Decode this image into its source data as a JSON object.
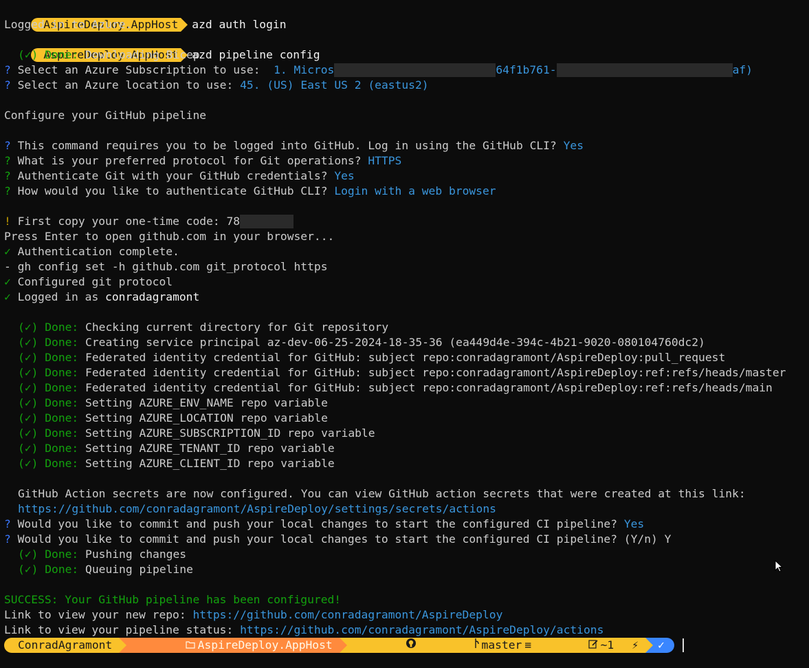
{
  "prompt_label": "AspireDeploy.AppHost",
  "lines": {
    "cmd1": "azd auth login",
    "out1": "Logged in to Azure.",
    "cmd2": "azd pipeline config",
    "done_label": "(✓) Done:",
    "bicep": " Downloading Bicep",
    "q_mark": "?",
    "sub_q": " Select an Azure Subscription to use:  ",
    "sub_a1": "1. Micros",
    "sub_a2": "64f1b761-",
    "sub_a3": "af)",
    "loc_q": " Select an Azure location to use: ",
    "loc_a": "45. (US) East US 2 (eastus2)",
    "configure": "Configure your GitHub pipeline",
    "gh_q1": " This command requires you to be logged into GitHub. Log in using the GitHub CLI? ",
    "gh_a1": "Yes",
    "gh_q2": " What is your preferred protocol for Git operations? ",
    "gh_a2": "HTTPS",
    "gh_q3": " Authenticate Git with your GitHub credentials? ",
    "gh_a3": "Yes",
    "gh_q4": " How would you like to authenticate GitHub CLI? ",
    "gh_a4": "Login with a web browser",
    "bang": "!",
    "code_txt": " First copy your one-time code: 78",
    "press_enter": "Press Enter to open github.com in your browser...",
    "check": "✓",
    "auth_complete": " Authentication complete.",
    "dash": "-",
    "gh_config": " gh config set -h github.com git_protocol https",
    "configured_proto": " Configured git protocol",
    "logged_in_as": " Logged in as ",
    "username": "conradagramont",
    "d1": " Checking current directory for Git repository",
    "d2": " Creating service principal az-dev-06-25-2024-18-35-36 (ea449d4e-394c-4b21-9020-080104760dc2)",
    "d3": " Federated identity credential for GitHub: subject repo:conradagramont/AspireDeploy:pull_request",
    "d4": " Federated identity credential for GitHub: subject repo:conradagramont/AspireDeploy:ref:refs/heads/master",
    "d5": " Federated identity credential for GitHub: subject repo:conradagramont/AspireDeploy:ref:refs/heads/main",
    "d6": " Setting AZURE_ENV_NAME repo variable",
    "d7": " Setting AZURE_LOCATION repo variable",
    "d8": " Setting AZURE_SUBSCRIPTION_ID repo variable",
    "d9": " Setting AZURE_TENANT_ID repo variable",
    "d10": " Setting AZURE_CLIENT_ID repo variable",
    "secrets_msg": "GitHub Action secrets are now configured. You can view GitHub action secrets that were created at this link:",
    "secrets_link": "https://github.com/conradagramont/AspireDeploy/settings/secrets/actions",
    "commit_q": " Would you like to commit and push your local changes to start the configured CI pipeline? ",
    "commit_a": "Yes",
    "commit_q2": " Would you like to commit and push your local changes to start the configured CI pipeline? (Y/n) Y",
    "push": " Pushing changes",
    "queue": " Queuing pipeline",
    "success": "SUCCESS: Your GitHub pipeline has been configured!",
    "repo_label": "Link to view your new repo: ",
    "repo_link": "https://github.com/conradagramont/AspireDeploy",
    "status_label": "Link to view your pipeline status: ",
    "status_link": "https://github.com/conradagramont/AspireDeploy/actions"
  },
  "status_bar": {
    "user": "ConradAgramont",
    "folder_icon": "folder-icon",
    "folder": "AspireDeploy.AppHost",
    "git_icon": "github-icon",
    "branch": "master",
    "equiv": "≡",
    "edit_icon": "edit-icon",
    "changes": "~1",
    "bolt": "⚡",
    "ok": "✓"
  },
  "colors": {
    "background": "#0c0c0c",
    "question": "#3b78ff",
    "done": "#13a10e",
    "answer": "#3a96dd",
    "prompt_yellow": "#f9c22a",
    "prompt_orange": "#ff8a3d",
    "prompt_blue": "#3a86ff"
  }
}
